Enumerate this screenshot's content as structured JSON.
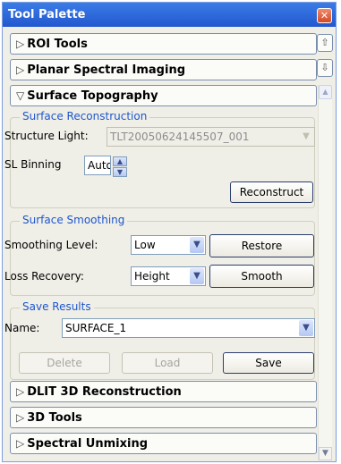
{
  "window": {
    "title": "Tool Palette",
    "close": "✕"
  },
  "sections": {
    "roi_tools": "ROI Tools",
    "planar": "Planar Spectral Imaging",
    "surface_topo": "Surface Topography",
    "dlit": "DLIT 3D Reconstruction",
    "tools3d": "3D Tools",
    "unmixing": "Spectral Unmixing"
  },
  "arrows": {
    "collapsed": "▷",
    "expanded": "▽"
  },
  "reconstruction": {
    "title": "Surface Reconstruction",
    "structure_label": "Structure Light:",
    "structure_value": "TLT20050624145507_001",
    "binning_label": "SL Binning",
    "binning_value": "Auto",
    "reconstruct_label": "Reconstruct"
  },
  "smoothing": {
    "title": "Surface Smoothing",
    "level_label": "Smoothing Level:",
    "level_value": "Low",
    "restore_label": "Restore",
    "loss_label": "Loss Recovery:",
    "loss_value": "Height",
    "smooth_label": "Smooth"
  },
  "save_results": {
    "title": "Save Results",
    "name_label": "Name:",
    "name_value": "SURFACE_1",
    "delete_label": "Delete",
    "load_label": "Load",
    "save_label": "Save"
  },
  "icons": {
    "dropdown": "▼",
    "spin_up": "▲",
    "spin_down": "▼",
    "scroll_up": "▲",
    "scroll_down": "▼",
    "side_up": "⇧",
    "side_down": "⇩"
  }
}
